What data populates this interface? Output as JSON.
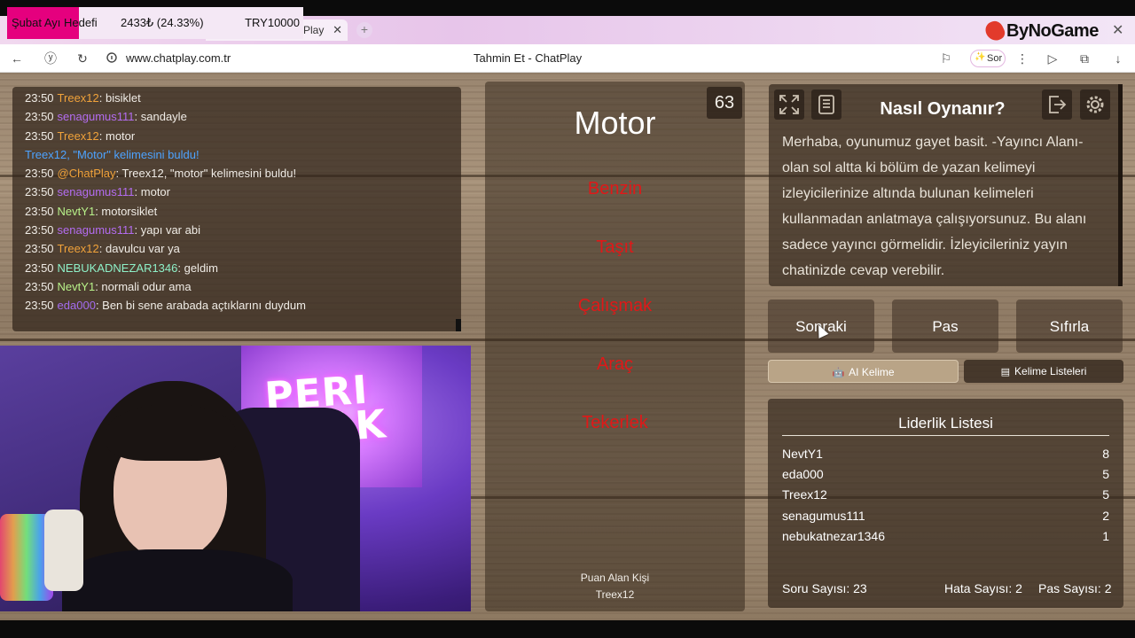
{
  "goal": {
    "label": "Şubat Ayı Hedefi",
    "amount": "2433₺ (24.33%)",
    "target": "TRY10000",
    "progress_percent": 24.33
  },
  "browser": {
    "tab_title": "Play",
    "url": "www.chatplay.com.tr",
    "page_title": "Tahmin Et - ChatPlay",
    "ask_label": "Sor",
    "brand": "ByNoGame"
  },
  "chat": {
    "messages": [
      {
        "time": "23:50",
        "user": "Treex12",
        "color": "#f0a23a",
        "text": ": bisiklet"
      },
      {
        "time": "23:50",
        "user": "senagumus111",
        "color": "#b36cf0",
        "text": ": sandayle"
      },
      {
        "time": "23:50",
        "user": "Treex12",
        "color": "#f0a23a",
        "text": ": motor"
      },
      {
        "system": "Treex12, \"Motor\" kelimesini buldu!"
      },
      {
        "time": "23:50",
        "user": "@ChatPlay",
        "color": "#f0a23a",
        "text": ": Treex12, \"motor\" kelimesini buldu!"
      },
      {
        "time": "23:50",
        "user": "senagumus111",
        "color": "#b36cf0",
        "text": ": motor"
      },
      {
        "time": "23:50",
        "user": "NevtY1",
        "color": "#b8f28a",
        "text": ": motorsiklet"
      },
      {
        "time": "23:50",
        "user": "senagumus111",
        "color": "#b36cf0",
        "text": ": yapı var abi"
      },
      {
        "time": "23:50",
        "user": "Treex12",
        "color": "#f0a23a",
        "text": ": davulcu var ya"
      },
      {
        "time": "23:50",
        "user": "NEBUKADNEZAR1346",
        "color": "#8ef0c8",
        "text": ": geldim"
      },
      {
        "time": "23:50",
        "user": "NevtY1",
        "color": "#b8f28a",
        "text": ": normali odur ama"
      },
      {
        "time": "23:50",
        "user": "eda000",
        "color": "#a46cf0",
        "text": ": Ben bi sene arabada açtıklarını duydum"
      }
    ]
  },
  "webcam": {
    "sign_line1": "PERI",
    "sign_line2": "PEAK"
  },
  "game": {
    "timer": "63",
    "word": "Motor",
    "taboo_words": [
      "Benzin",
      "Taşıt",
      "Çalışmak",
      "Araç",
      "Tekerlek"
    ],
    "scorer_label": "Puan Alan Kişi",
    "scorer_name": "Treex12"
  },
  "howto": {
    "title": "Nasıl Oynanır?",
    "text": "Merhaba, oyunumuz gayet basit. -Yayıncı Alanı- olan sol altta ki bölüm de yazan kelimeyi izleyicilerinize altında bulunan kelimeleri kullanmadan anlatmaya çalışıyorsunuz. Bu alanı sadece yayıncı görmelidir. İzleyicileriniz yayın chatinizde cevap verebilir."
  },
  "actions": {
    "next": "Sonraki",
    "pass": "Pas",
    "reset": "Sıfırla",
    "ai_word": "AI Kelime",
    "word_lists": "Kelime Listeleri"
  },
  "leaderboard": {
    "title": "Liderlik Listesi",
    "rows": [
      {
        "name": "NevtY1",
        "score": "8"
      },
      {
        "name": "eda000",
        "score": "5"
      },
      {
        "name": "Treex12",
        "score": "5"
      },
      {
        "name": "senagumus111",
        "score": "2"
      },
      {
        "name": "nebukatnezar1346",
        "score": "1"
      }
    ],
    "question_count": "Soru Sayısı: 23",
    "error_count": "Hata Sayısı: 2",
    "pass_count": "Pas Sayısı: 2"
  },
  "colors": {
    "accent_pink": "#e5007e",
    "taboo_red": "#e01818",
    "system_blue": "#4da3ff"
  }
}
